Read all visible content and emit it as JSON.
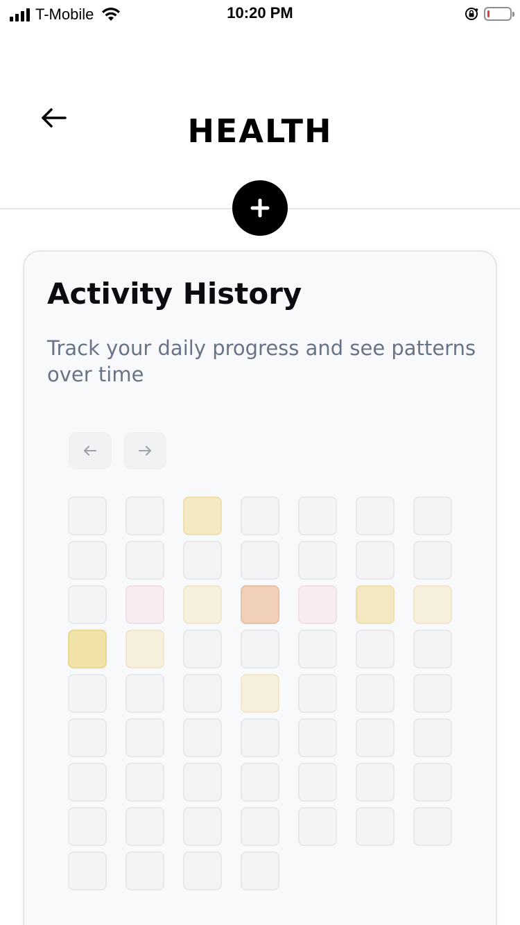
{
  "status_bar": {
    "carrier": "T-Mobile",
    "time": "10:20 PM",
    "battery_level_fraction": 0.08
  },
  "header": {
    "title": "HEALTH",
    "back_icon": "arrow-left-icon",
    "add_icon": "plus-icon"
  },
  "card": {
    "title": "Activity History",
    "description": "Track your daily progress and see patterns over time",
    "prev_icon": "arrow-left-icon",
    "next_icon": "arrow-right-icon"
  },
  "palette": {
    "empty": "#f3f4f6",
    "yellow": "#f3e8c2",
    "cream": "#f6f0dc",
    "pink": "#f8ebf1",
    "peach": "#f0d0b8",
    "gold": "#f1e2a8"
  },
  "calendar": {
    "cells": [
      "empty",
      "empty",
      "yellow",
      "empty",
      "empty",
      "empty",
      "empty",
      "empty",
      "empty",
      "empty",
      "empty",
      "empty",
      "empty",
      "empty",
      "empty",
      "pink",
      "cream",
      "peach",
      "pink",
      "yellow",
      "cream",
      "gold",
      "cream",
      "empty",
      "empty",
      "empty",
      "empty",
      "empty",
      "empty",
      "empty",
      "empty",
      "cream",
      "empty",
      "empty",
      "empty",
      "empty",
      "empty",
      "empty",
      "empty",
      "empty",
      "empty",
      "empty",
      "empty",
      "empty",
      "empty",
      "empty",
      "empty",
      "empty",
      "empty",
      "empty",
      "empty",
      "empty",
      "empty",
      "empty",
      "empty",
      "empty",
      "empty",
      "empty",
      "empty",
      "empty"
    ]
  }
}
